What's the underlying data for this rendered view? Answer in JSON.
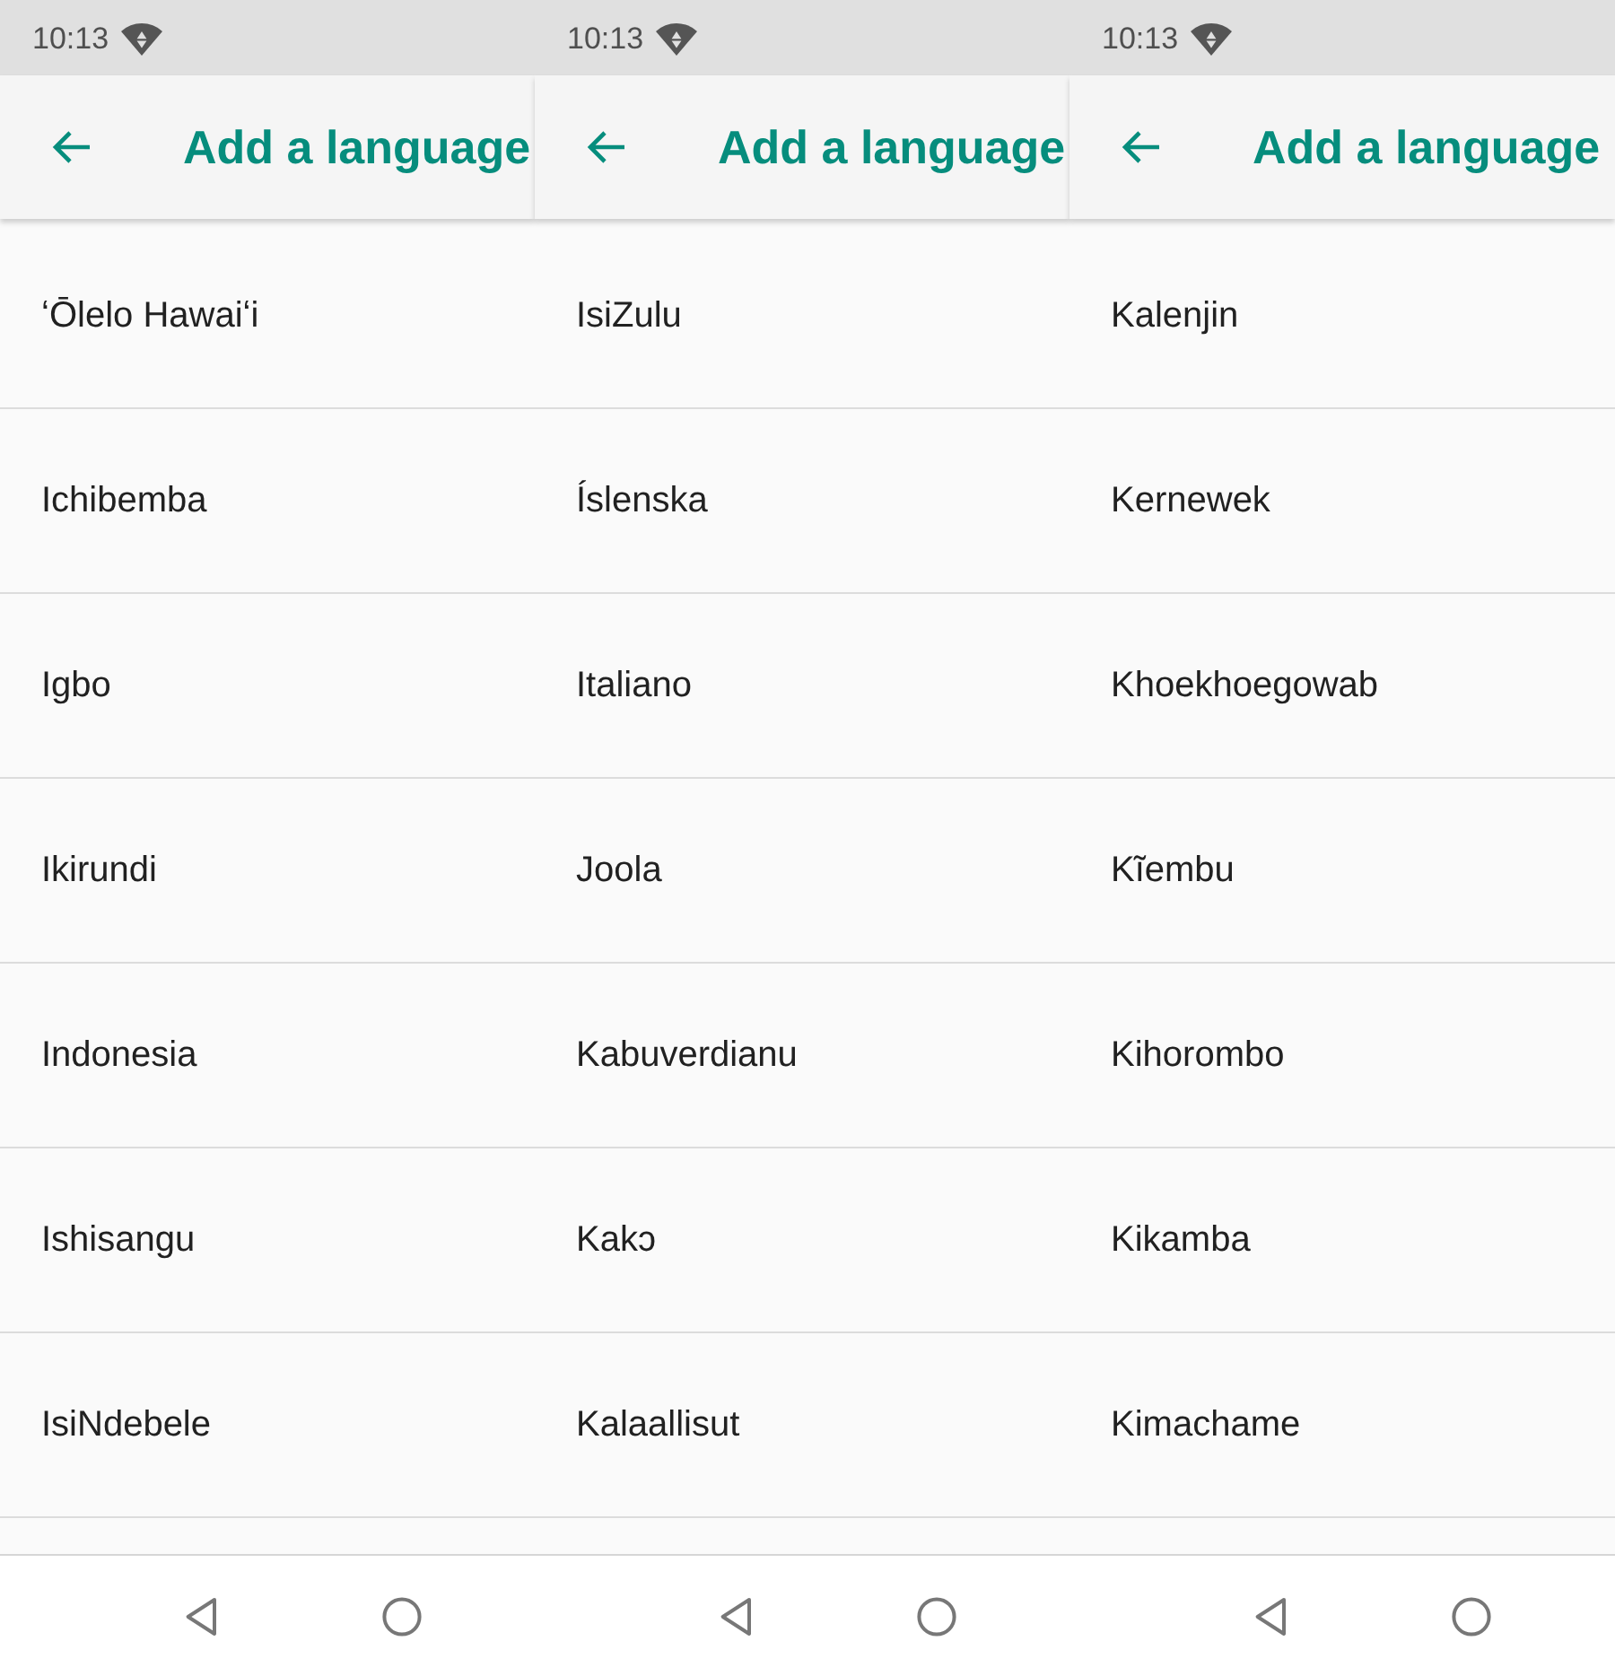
{
  "panels": [
    {
      "status_bar": {
        "time": "10:13"
      },
      "app_bar": {
        "title": "Add a language"
      },
      "languages": [
        "ʻŌlelo Hawaiʻi",
        "Ichibemba",
        "Igbo",
        "Ikirundi",
        "Indonesia",
        "Ishisangu",
        "IsiNdebele"
      ]
    },
    {
      "status_bar": {
        "time": "10:13"
      },
      "app_bar": {
        "title": "Add a language"
      },
      "languages": [
        "IsiZulu",
        "Íslenska",
        "Italiano",
        "Joola",
        "Kabuverdianu",
        "Kakɔ",
        "Kalaallisut"
      ]
    },
    {
      "status_bar": {
        "time": "10:13"
      },
      "app_bar": {
        "title": "Add a language"
      },
      "languages": [
        "Kalenjin",
        "Kernewek",
        "Khoekhoegowab",
        "Kĩembu",
        "Kihorombo",
        "Kikamba",
        "Kimachame"
      ]
    }
  ]
}
